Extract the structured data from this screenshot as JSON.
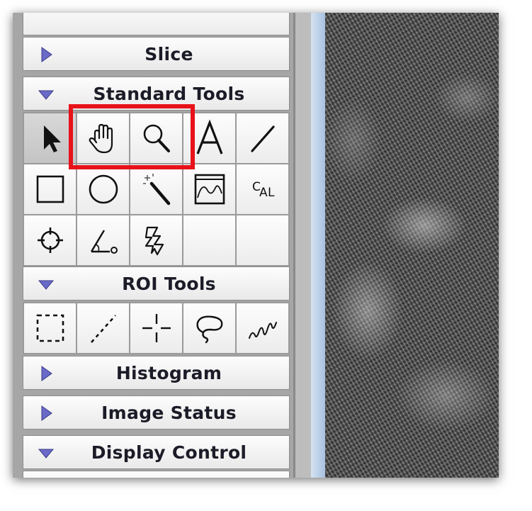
{
  "palette": {
    "slice": {
      "label": "Slice",
      "expanded": false
    },
    "standard_tools": {
      "label": "Standard Tools",
      "expanded": true,
      "tools": [
        {
          "icon": "arrow-pointer-icon",
          "selected": true
        },
        {
          "icon": "hand-pan-icon",
          "highlighted": true
        },
        {
          "icon": "magnifier-zoom-icon",
          "highlighted": true
        },
        {
          "icon": "text-tool-icon",
          "glyph": "A"
        },
        {
          "icon": "line-tool-icon"
        },
        {
          "icon": "rectangle-tool-icon"
        },
        {
          "icon": "oval-tool-icon"
        },
        {
          "icon": "magic-wand-icon"
        },
        {
          "icon": "profile-tool-icon"
        },
        {
          "icon": "calibration-tool-icon",
          "glyph": "C A L"
        },
        {
          "icon": "crosshair-target-icon"
        },
        {
          "icon": "angle-tool-icon"
        },
        {
          "icon": "lightning-tool-icon"
        },
        {
          "icon": "empty-slot"
        },
        {
          "icon": "empty-slot"
        }
      ]
    },
    "roi_tools": {
      "label": "ROI Tools",
      "expanded": true,
      "tools": [
        {
          "icon": "dashed-rectangle-roi-icon"
        },
        {
          "icon": "dashed-line-roi-icon"
        },
        {
          "icon": "point-roi-icon"
        },
        {
          "icon": "lasso-roi-icon"
        },
        {
          "icon": "freehand-roi-icon"
        }
      ]
    },
    "histogram": {
      "label": "Histogram",
      "expanded": false
    },
    "image_status": {
      "label": "Image Status",
      "expanded": false
    },
    "display_control": {
      "label": "Display Control",
      "expanded": true
    }
  },
  "colors": {
    "highlight_box": "#e8121a",
    "triangle": "#6a6ac8",
    "header_text": "#1c1c28"
  }
}
